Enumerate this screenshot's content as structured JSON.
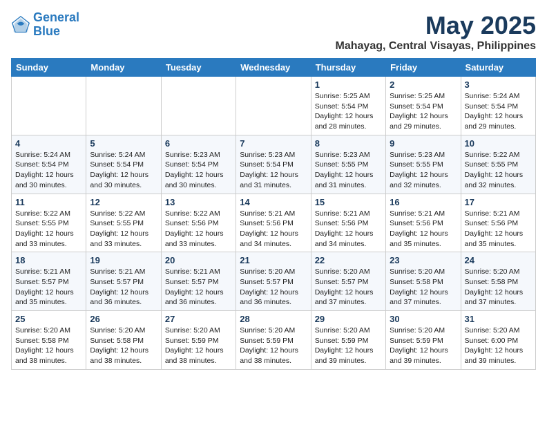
{
  "logo": {
    "line1": "General",
    "line2": "Blue"
  },
  "title": "May 2025",
  "location": "Mahayag, Central Visayas, Philippines",
  "days_of_week": [
    "Sunday",
    "Monday",
    "Tuesday",
    "Wednesday",
    "Thursday",
    "Friday",
    "Saturday"
  ],
  "weeks": [
    [
      {
        "day": "",
        "info": ""
      },
      {
        "day": "",
        "info": ""
      },
      {
        "day": "",
        "info": ""
      },
      {
        "day": "",
        "info": ""
      },
      {
        "day": "1",
        "info": "Sunrise: 5:25 AM\nSunset: 5:54 PM\nDaylight: 12 hours\nand 28 minutes."
      },
      {
        "day": "2",
        "info": "Sunrise: 5:25 AM\nSunset: 5:54 PM\nDaylight: 12 hours\nand 29 minutes."
      },
      {
        "day": "3",
        "info": "Sunrise: 5:24 AM\nSunset: 5:54 PM\nDaylight: 12 hours\nand 29 minutes."
      }
    ],
    [
      {
        "day": "4",
        "info": "Sunrise: 5:24 AM\nSunset: 5:54 PM\nDaylight: 12 hours\nand 30 minutes."
      },
      {
        "day": "5",
        "info": "Sunrise: 5:24 AM\nSunset: 5:54 PM\nDaylight: 12 hours\nand 30 minutes."
      },
      {
        "day": "6",
        "info": "Sunrise: 5:23 AM\nSunset: 5:54 PM\nDaylight: 12 hours\nand 30 minutes."
      },
      {
        "day": "7",
        "info": "Sunrise: 5:23 AM\nSunset: 5:54 PM\nDaylight: 12 hours\nand 31 minutes."
      },
      {
        "day": "8",
        "info": "Sunrise: 5:23 AM\nSunset: 5:55 PM\nDaylight: 12 hours\nand 31 minutes."
      },
      {
        "day": "9",
        "info": "Sunrise: 5:23 AM\nSunset: 5:55 PM\nDaylight: 12 hours\nand 32 minutes."
      },
      {
        "day": "10",
        "info": "Sunrise: 5:22 AM\nSunset: 5:55 PM\nDaylight: 12 hours\nand 32 minutes."
      }
    ],
    [
      {
        "day": "11",
        "info": "Sunrise: 5:22 AM\nSunset: 5:55 PM\nDaylight: 12 hours\nand 33 minutes."
      },
      {
        "day": "12",
        "info": "Sunrise: 5:22 AM\nSunset: 5:55 PM\nDaylight: 12 hours\nand 33 minutes."
      },
      {
        "day": "13",
        "info": "Sunrise: 5:22 AM\nSunset: 5:56 PM\nDaylight: 12 hours\nand 33 minutes."
      },
      {
        "day": "14",
        "info": "Sunrise: 5:21 AM\nSunset: 5:56 PM\nDaylight: 12 hours\nand 34 minutes."
      },
      {
        "day": "15",
        "info": "Sunrise: 5:21 AM\nSunset: 5:56 PM\nDaylight: 12 hours\nand 34 minutes."
      },
      {
        "day": "16",
        "info": "Sunrise: 5:21 AM\nSunset: 5:56 PM\nDaylight: 12 hours\nand 35 minutes."
      },
      {
        "day": "17",
        "info": "Sunrise: 5:21 AM\nSunset: 5:56 PM\nDaylight: 12 hours\nand 35 minutes."
      }
    ],
    [
      {
        "day": "18",
        "info": "Sunrise: 5:21 AM\nSunset: 5:57 PM\nDaylight: 12 hours\nand 35 minutes."
      },
      {
        "day": "19",
        "info": "Sunrise: 5:21 AM\nSunset: 5:57 PM\nDaylight: 12 hours\nand 36 minutes."
      },
      {
        "day": "20",
        "info": "Sunrise: 5:21 AM\nSunset: 5:57 PM\nDaylight: 12 hours\nand 36 minutes."
      },
      {
        "day": "21",
        "info": "Sunrise: 5:20 AM\nSunset: 5:57 PM\nDaylight: 12 hours\nand 36 minutes."
      },
      {
        "day": "22",
        "info": "Sunrise: 5:20 AM\nSunset: 5:57 PM\nDaylight: 12 hours\nand 37 minutes."
      },
      {
        "day": "23",
        "info": "Sunrise: 5:20 AM\nSunset: 5:58 PM\nDaylight: 12 hours\nand 37 minutes."
      },
      {
        "day": "24",
        "info": "Sunrise: 5:20 AM\nSunset: 5:58 PM\nDaylight: 12 hours\nand 37 minutes."
      }
    ],
    [
      {
        "day": "25",
        "info": "Sunrise: 5:20 AM\nSunset: 5:58 PM\nDaylight: 12 hours\nand 38 minutes."
      },
      {
        "day": "26",
        "info": "Sunrise: 5:20 AM\nSunset: 5:58 PM\nDaylight: 12 hours\nand 38 minutes."
      },
      {
        "day": "27",
        "info": "Sunrise: 5:20 AM\nSunset: 5:59 PM\nDaylight: 12 hours\nand 38 minutes."
      },
      {
        "day": "28",
        "info": "Sunrise: 5:20 AM\nSunset: 5:59 PM\nDaylight: 12 hours\nand 38 minutes."
      },
      {
        "day": "29",
        "info": "Sunrise: 5:20 AM\nSunset: 5:59 PM\nDaylight: 12 hours\nand 39 minutes."
      },
      {
        "day": "30",
        "info": "Sunrise: 5:20 AM\nSunset: 5:59 PM\nDaylight: 12 hours\nand 39 minutes."
      },
      {
        "day": "31",
        "info": "Sunrise: 5:20 AM\nSunset: 6:00 PM\nDaylight: 12 hours\nand 39 minutes."
      }
    ]
  ]
}
